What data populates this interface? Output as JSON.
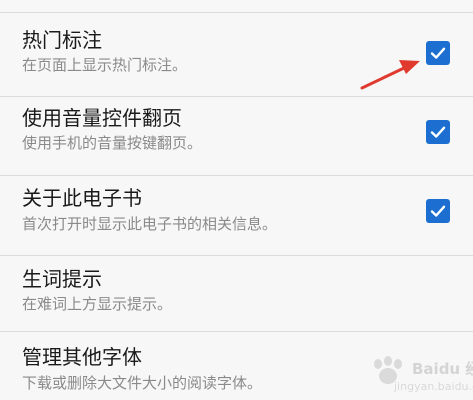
{
  "settings": {
    "items": [
      {
        "title": "热门标注",
        "subtitle": "在页面上显示热门标注。",
        "checked": true
      },
      {
        "title": "使用音量控件翻页",
        "subtitle": "使用手机的音量按键翻页。",
        "checked": true
      },
      {
        "title": "关于此电子书",
        "subtitle": "首次打开时显示此电子书的相关信息。",
        "checked": true
      },
      {
        "title": "生词提示",
        "subtitle": "在难词上方显示提示。",
        "checked": null
      },
      {
        "title": "管理其他字体",
        "subtitle": "下载或删除大文件大小的阅读字体。",
        "checked": null
      }
    ]
  },
  "annotation": {
    "arrow_color": "#e03a2f"
  },
  "watermark": {
    "brand": "Baidu 经验",
    "url": "jingyan.baidu.com"
  },
  "colors": {
    "accent": "#1c6fd0",
    "background": "#f7f7f7",
    "title": "#1a1a1a",
    "subtitle": "#8a8a8a"
  }
}
